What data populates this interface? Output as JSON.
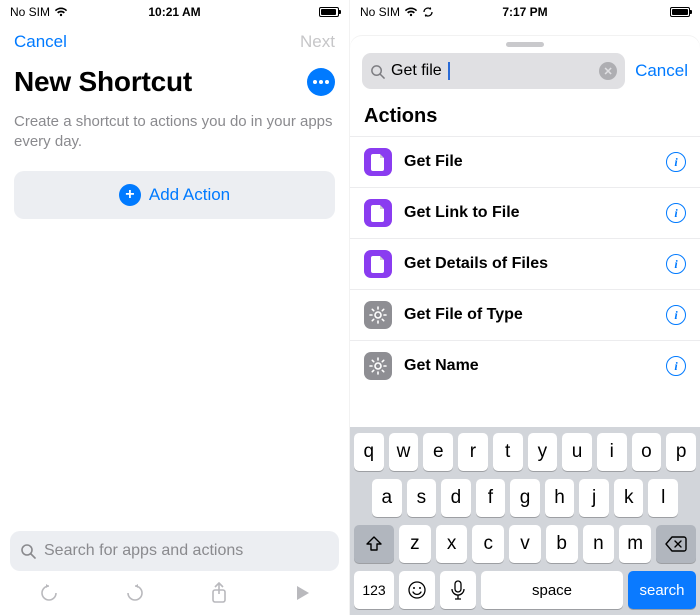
{
  "left": {
    "status": {
      "carrier": "No SIM",
      "time": "10:21 AM",
      "battery_pct": 92
    },
    "nav": {
      "cancel": "Cancel",
      "next": "Next"
    },
    "title": "New Shortcut",
    "subtitle": "Create a shortcut to actions you do in your apps every day.",
    "add_action": "Add Action",
    "search_placeholder": "Search for apps and actions"
  },
  "right": {
    "status": {
      "carrier": "No SIM",
      "time": "7:17 PM",
      "battery_pct": 98
    },
    "search": {
      "query": "Get file",
      "cancel": "Cancel"
    },
    "section_title": "Actions",
    "actions": [
      {
        "label": "Get File",
        "icon": "file-icon",
        "tint": "purple"
      },
      {
        "label": "Get Link to File",
        "icon": "file-icon",
        "tint": "purple"
      },
      {
        "label": "Get Details of Files",
        "icon": "file-icon",
        "tint": "purple"
      },
      {
        "label": "Get File of Type",
        "icon": "gear-icon",
        "tint": "gray"
      },
      {
        "label": "Get Name",
        "icon": "gear-icon",
        "tint": "gray"
      }
    ],
    "keyboard": {
      "row1": [
        "q",
        "w",
        "e",
        "r",
        "t",
        "y",
        "u",
        "i",
        "o",
        "p"
      ],
      "row2": [
        "a",
        "s",
        "d",
        "f",
        "g",
        "h",
        "j",
        "k",
        "l"
      ],
      "row3": [
        "z",
        "x",
        "c",
        "v",
        "b",
        "n",
        "m"
      ],
      "numbers": "123",
      "space": "space",
      "search": "search"
    }
  }
}
